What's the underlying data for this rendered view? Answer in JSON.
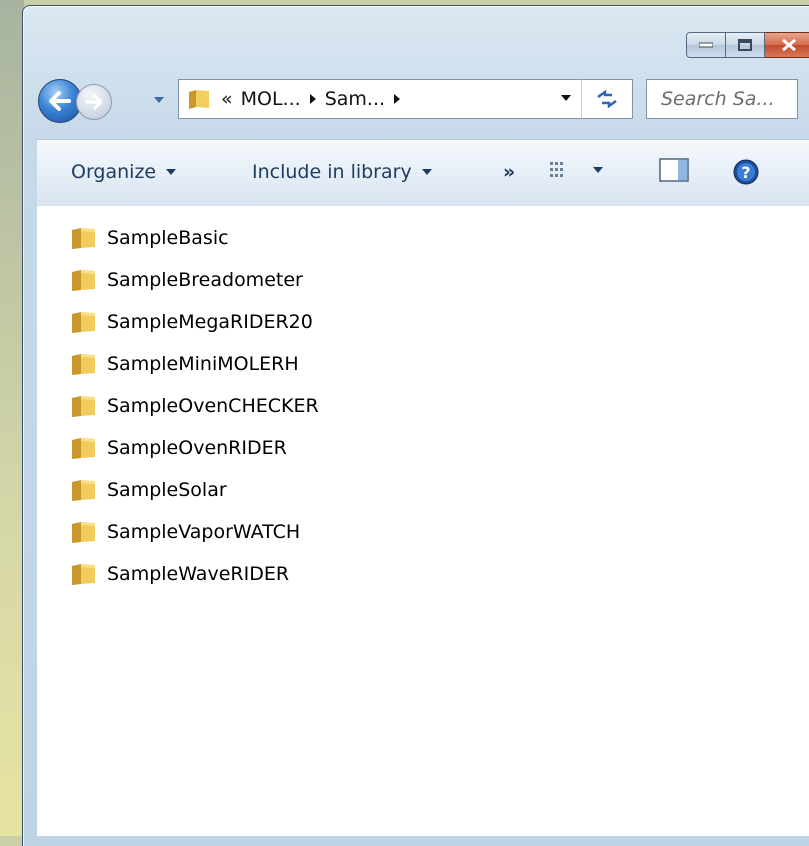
{
  "window": {
    "caption": {
      "minimize_icon": "minimize-icon",
      "maximize_icon": "maximize-icon",
      "close_icon": "close-icon"
    }
  },
  "nav": {
    "address": {
      "prefix": "«",
      "crumbs": [
        "MOL...",
        "Sam..."
      ]
    },
    "search": {
      "placeholder": "Search Sa..."
    }
  },
  "toolbar": {
    "organize": "Organize",
    "include_in_library": "Include in library",
    "more": "»"
  },
  "files": [
    {
      "name": "SampleBasic"
    },
    {
      "name": "SampleBreadometer"
    },
    {
      "name": "SampleMegaRIDER20"
    },
    {
      "name": "SampleMiniMOLERH"
    },
    {
      "name": "SampleOvenCHECKER"
    },
    {
      "name": "SampleOvenRIDER"
    },
    {
      "name": "SampleSolar"
    },
    {
      "name": "SampleVaporWATCH"
    },
    {
      "name": "SampleWaveRIDER"
    }
  ],
  "colors": {
    "accent": "#3b83d6",
    "close": "#c24a2a",
    "folder": "#e8c25a"
  }
}
